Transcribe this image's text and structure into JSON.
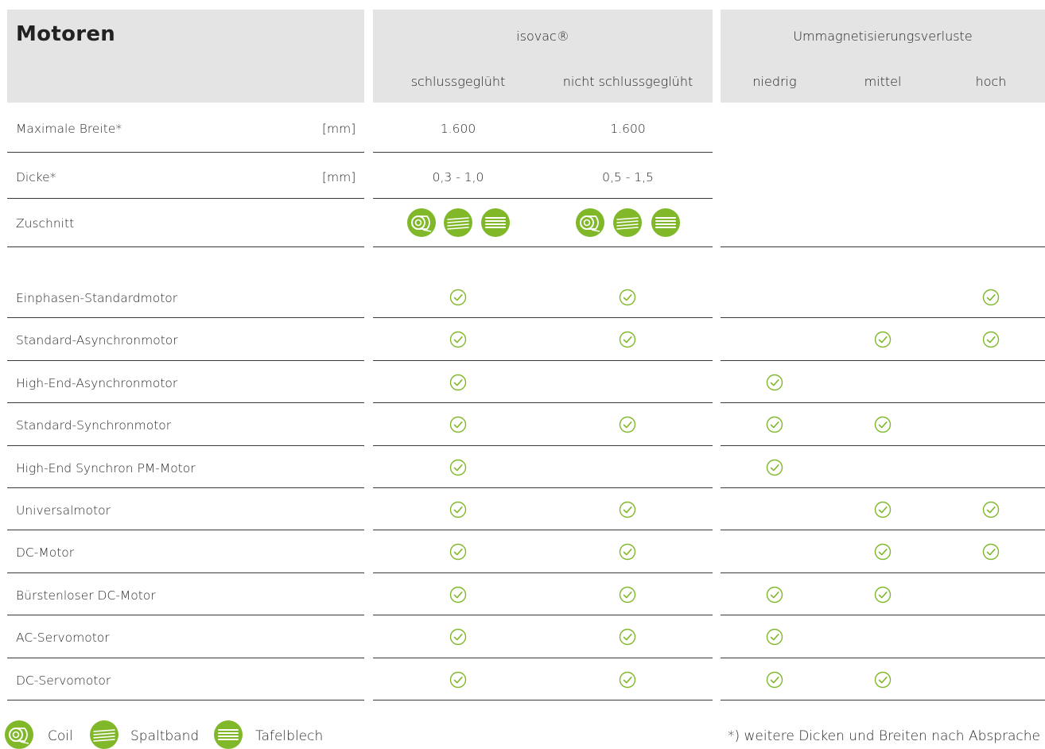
{
  "title": "Motoren",
  "groups": {
    "isovac": "isovac®",
    "losses": "Ummagnetisierungsverluste"
  },
  "subheaders": {
    "annealed": "schlussgeglüht",
    "not_annealed": "nicht schlussgeglüht",
    "low": "niedrig",
    "medium": "mittel",
    "high": "hoch"
  },
  "specs": [
    {
      "label": "Maximale Breite*",
      "unit": "[mm]",
      "annealed": "1.600",
      "not_annealed": "1.600"
    },
    {
      "label": "Dicke*",
      "unit": "[mm]",
      "annealed": "0,3 - 1,0",
      "not_annealed": "0,5 - 1,5"
    },
    {
      "label": "Zuschnitt",
      "unit": "",
      "annealed": "",
      "not_annealed": ""
    }
  ],
  "cut_icons": [
    "coil-icon",
    "slit-strip-icon",
    "sheet-icon"
  ],
  "motors": [
    {
      "label": "Einphasen-Standardmotor",
      "checks": [
        true,
        true,
        false,
        false,
        true
      ]
    },
    {
      "label": "Standard-Asynchronmotor",
      "checks": [
        true,
        true,
        false,
        true,
        true
      ]
    },
    {
      "label": "High-End-Asynchronmotor",
      "checks": [
        true,
        false,
        true,
        false,
        false
      ]
    },
    {
      "label": "Standard-Synchronmotor",
      "checks": [
        true,
        true,
        true,
        true,
        false
      ]
    },
    {
      "label": "High-End Synchron PM-Motor",
      "checks": [
        true,
        false,
        true,
        false,
        false
      ]
    },
    {
      "label": "Universalmotor",
      "checks": [
        true,
        true,
        false,
        true,
        true
      ]
    },
    {
      "label": "DC-Motor",
      "checks": [
        true,
        true,
        false,
        true,
        true
      ]
    },
    {
      "label": "Bürstenloser DC-Motor",
      "checks": [
        true,
        true,
        true,
        true,
        false
      ]
    },
    {
      "label": "AC-Servomotor",
      "checks": [
        true,
        true,
        true,
        false,
        false
      ]
    },
    {
      "label": "DC-Servomotor",
      "checks": [
        true,
        true,
        true,
        true,
        false
      ]
    }
  ],
  "legend": {
    "coil": "Coil",
    "slit_strip": "Spaltband",
    "sheet": "Tafelblech"
  },
  "footnote": "*) weitere Dicken und Breiten nach Absprache",
  "colors": {
    "accent": "#80b82a",
    "header_bg": "#e4e4e4",
    "rule": "#3a3a3a"
  }
}
